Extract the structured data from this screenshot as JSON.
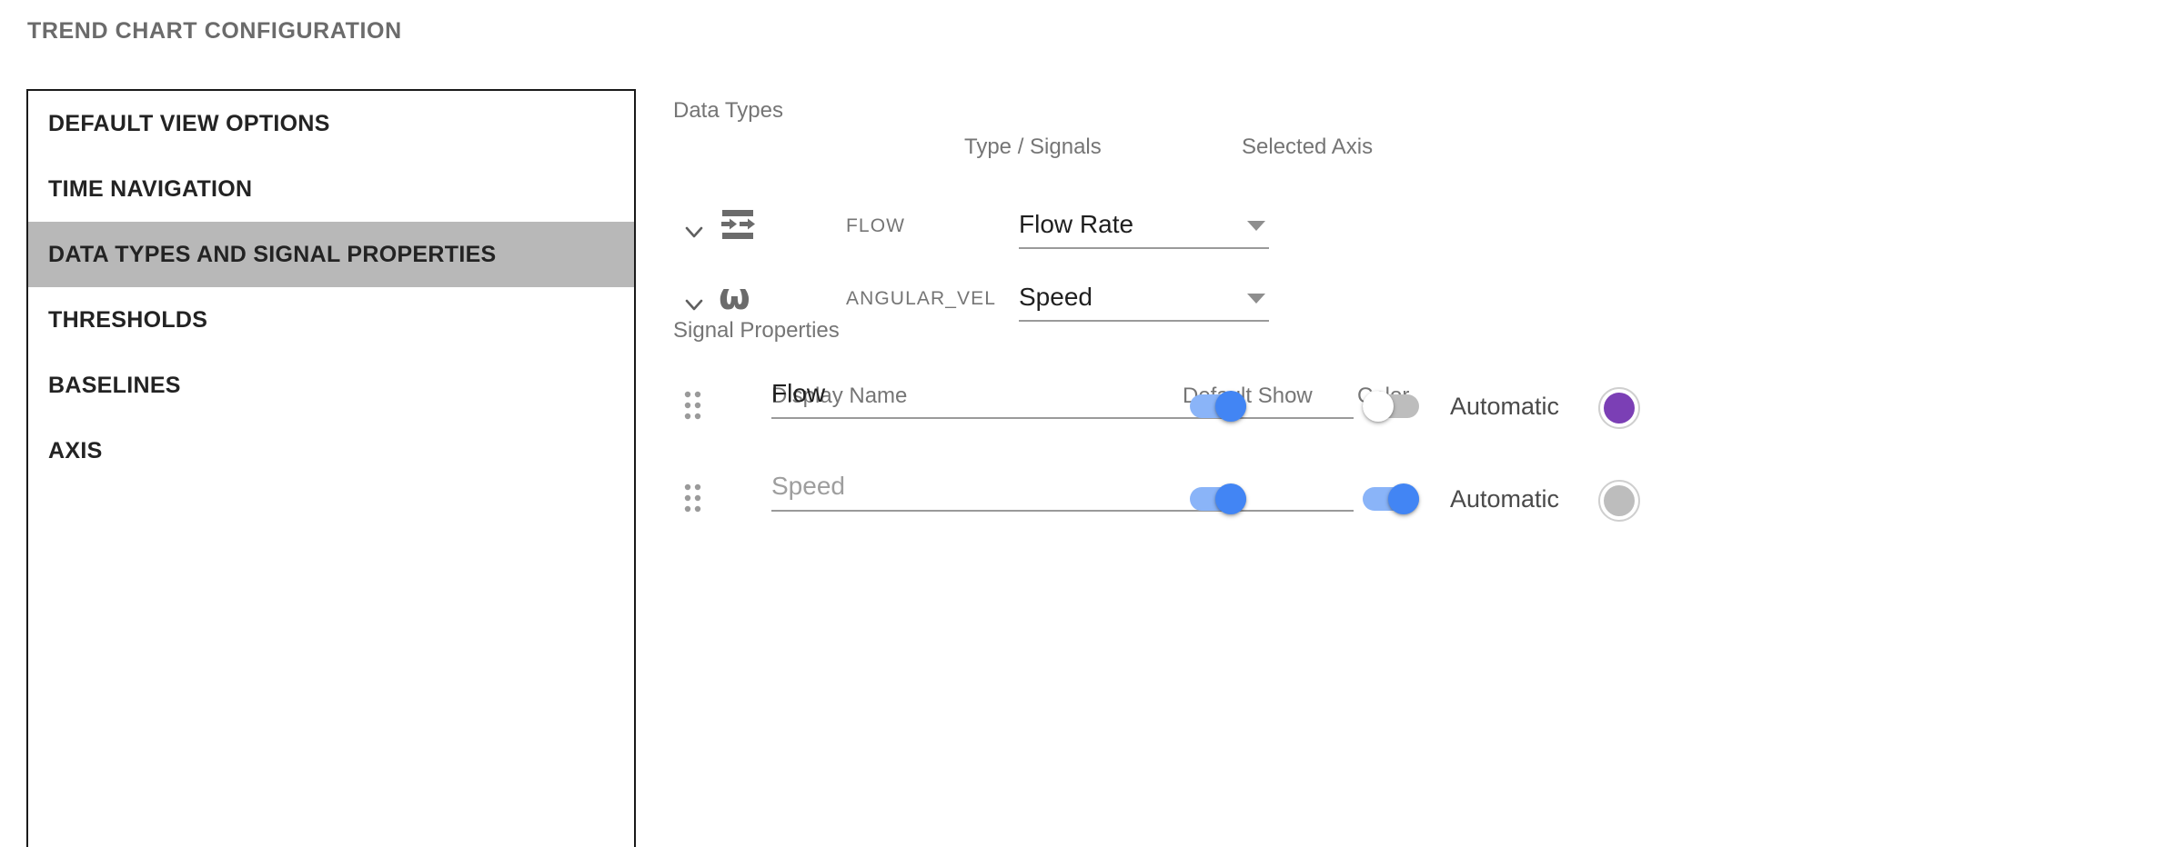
{
  "page_title": "TREND CHART CONFIGURATION",
  "sidebar": {
    "items": [
      {
        "label": "DEFAULT VIEW OPTIONS",
        "active": false
      },
      {
        "label": "TIME NAVIGATION",
        "active": false
      },
      {
        "label": "DATA TYPES AND SIGNAL PROPERTIES",
        "active": true
      },
      {
        "label": "THRESHOLDS",
        "active": false
      },
      {
        "label": "BASELINES",
        "active": false
      },
      {
        "label": "AXIS",
        "active": false
      }
    ]
  },
  "data_types": {
    "section_label": "Data Types",
    "columns": {
      "type_signals": "Type / Signals",
      "selected_axis": "Selected Axis"
    },
    "rows": [
      {
        "icon": "flow-icon",
        "expand_icon": "chevron-down-icon",
        "name": "FLOW",
        "selected_axis": "Flow Rate"
      },
      {
        "icon": "omega-icon",
        "icon_glyph": "ω",
        "expand_icon": "chevron-down-icon",
        "name": "ANGULAR_VEL",
        "selected_axis": "Speed"
      }
    ]
  },
  "signal_properties": {
    "section_label": "Signal Properties",
    "columns": {
      "display_name": "Display Name",
      "default_show": "Default Show",
      "color": "Color"
    },
    "rows": [
      {
        "drag_icon": "drag-handle-icon",
        "display_name_value": "Flow",
        "display_name_placeholder": "",
        "display_name_is_placeholder": false,
        "default_show": true,
        "color_automatic": false,
        "automatic_label": "Automatic",
        "color_hex": "#7b3fb5"
      },
      {
        "drag_icon": "drag-handle-icon",
        "display_name_value": "",
        "display_name_placeholder": "Speed",
        "display_name_is_placeholder": true,
        "default_show": true,
        "color_automatic": true,
        "automatic_label": "Automatic",
        "color_hex": "#bdbdbd"
      }
    ]
  },
  "colors": {
    "accent_blue": "#4285f4",
    "track_blue": "#8ab4f8",
    "track_gray": "#bdbdbd",
    "active_row": "#b8b8b8",
    "label_gray": "#757575"
  }
}
